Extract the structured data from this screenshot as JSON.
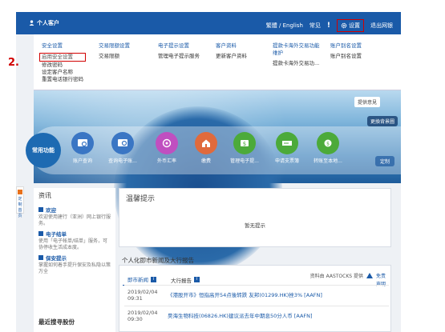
{
  "header": {
    "account_label": "个人客户",
    "lang": "繁體 / English",
    "faq": "常见",
    "settings": "设置",
    "logout": "退出网银"
  },
  "dropdown": {
    "columns": [
      {
        "head": "安全设置",
        "items": [
          "启用安全设置",
          "修改密码",
          "设定客户名称",
          "重置电话银行密码"
        ]
      },
      {
        "head": "交易限额设置",
        "items": [
          "交易限额"
        ]
      },
      {
        "head": "电子提示设置",
        "items": [
          "管理电子提示服务"
        ]
      },
      {
        "head": "客户资料",
        "items": [
          "更新客户资料"
        ]
      },
      {
        "head": "提款卡海外交易功能维护",
        "items": [
          "提款卡海外交易功..."
        ]
      },
      {
        "head": "账户别名设置",
        "items": [
          "账户别名设置"
        ]
      }
    ]
  },
  "step_marker": "2.",
  "hero": {
    "feedback": "提供意見",
    "switch": "更換背景圖",
    "func_label": "常用功能",
    "custom": "定制",
    "functions": [
      {
        "label": "账户查询",
        "icon": "account-inquiry-icon",
        "color": "#3a76c4"
      },
      {
        "label": "查询电子账...",
        "icon": "e-statement-icon",
        "color": "#3a76c4"
      },
      {
        "label": "外币汇率",
        "icon": "fx-rate-icon",
        "color": "#c04fc0"
      },
      {
        "label": "缴费",
        "icon": "bill-payment-icon",
        "color": "#e06a3c"
      },
      {
        "label": "管理电子提...",
        "icon": "e-alert-icon",
        "color": "#4caa3a"
      },
      {
        "label": "申请支票簿",
        "icon": "cheque-book-icon",
        "color": "#4caa3a"
      },
      {
        "label": "转账至本地...",
        "icon": "transfer-icon",
        "color": "#4caa3a"
      }
    ]
  },
  "side_tab": "定制首页",
  "left_panel": {
    "title": "资讯",
    "news": [
      {
        "head": "欢迎",
        "text": "欢迎使用建行（亚洲）网上银行服务。"
      },
      {
        "head": "电子结单",
        "text": "使用「电子帐单/结单」服务，可协停收生活成本度。"
      },
      {
        "head": "保安提示",
        "text": "掌握如何着手提升保安及私隐以策万全"
      }
    ],
    "search_title": "最近搜寻股份"
  },
  "tip": {
    "title": "温馨提示",
    "body": "暂无提示"
  },
  "news": {
    "title": "个人化即市新闻及大行报告",
    "tabs": [
      "即市新闻",
      "大行报告"
    ],
    "source": "资料由 AASTOCKS 提供",
    "free": "免责",
    "decl": "声明",
    "rows": [
      {
        "date": "2019/02/04",
        "time": "09:31",
        "headline": "《港股开市》恒指高开54点後转跌  友邦(01299.HK)挫3%  [AAFN]"
      },
      {
        "date": "2019/02/04",
        "time": "09:30",
        "headline": "昊海生物科技(06826.HK)建议派去年中期息50分人币  [AAFN]"
      }
    ]
  }
}
